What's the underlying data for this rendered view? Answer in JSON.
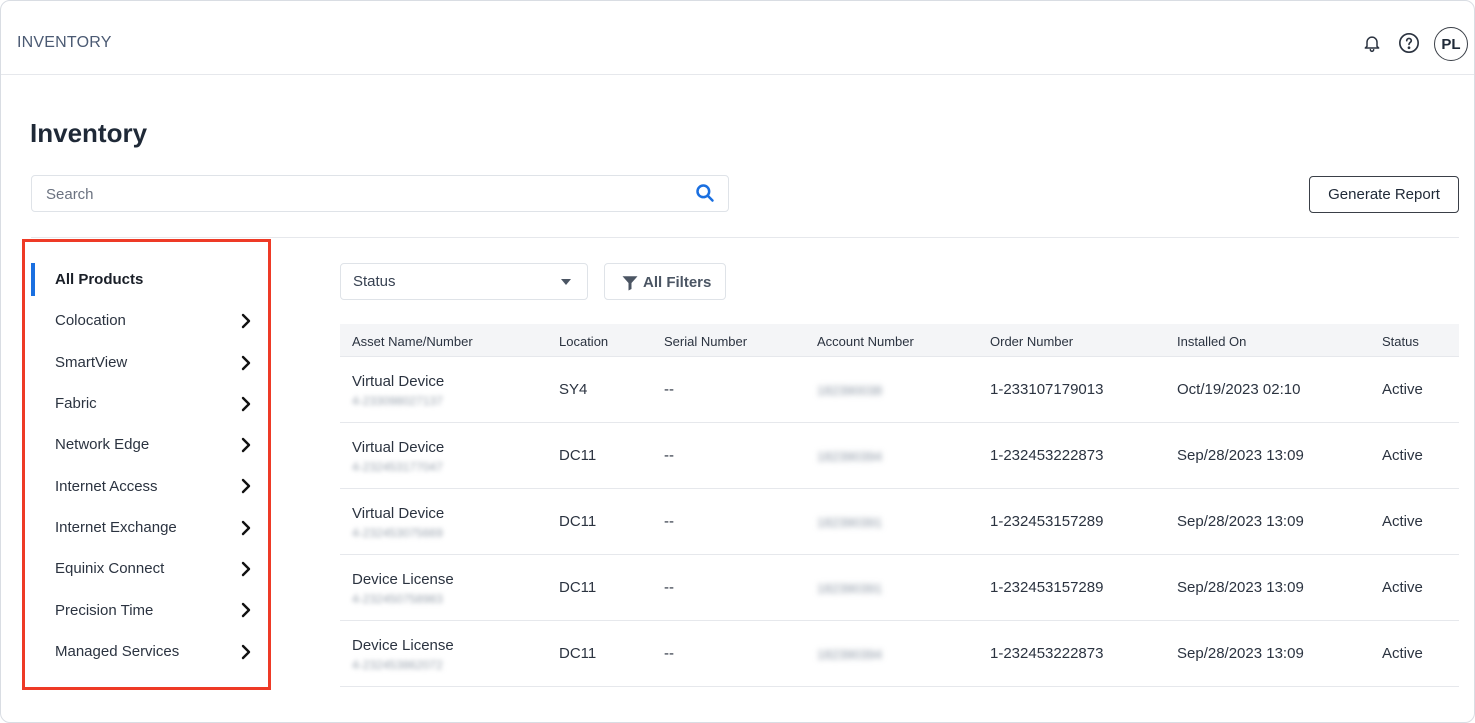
{
  "header": {
    "app_title": "INVENTORY",
    "avatar_initials": "PL",
    "icons": [
      "bell-icon",
      "help-icon"
    ]
  },
  "page": {
    "title": "Inventory"
  },
  "search": {
    "placeholder": "Search",
    "value": ""
  },
  "actions": {
    "generate_report": "Generate Report"
  },
  "sidebar": {
    "items": [
      {
        "label": "All Products",
        "active": true
      },
      {
        "label": "Colocation"
      },
      {
        "label": "SmartView"
      },
      {
        "label": "Fabric"
      },
      {
        "label": "Network Edge"
      },
      {
        "label": "Internet Access"
      },
      {
        "label": "Internet Exchange"
      },
      {
        "label": "Equinix Connect"
      },
      {
        "label": "Precision Time"
      },
      {
        "label": "Managed Services"
      }
    ]
  },
  "filters": {
    "status_label": "Status",
    "all_filters_label": "All Filters"
  },
  "table": {
    "columns": [
      "Asset Name/Number",
      "Location",
      "Serial Number",
      "Account Number",
      "Order Number",
      "Installed On",
      "Status"
    ],
    "rows": [
      {
        "name": "Virtual Device",
        "number": "4-233098027137",
        "location": "SY4",
        "serial": "--",
        "account": "182390038",
        "order": "1-233107179013",
        "installed": "Oct/19/2023 02:10",
        "status": "Active"
      },
      {
        "name": "Virtual Device",
        "number": "4-232453177047",
        "location": "DC11",
        "serial": "--",
        "account": "182390394",
        "order": "1-232453222873",
        "installed": "Sep/28/2023 13:09",
        "status": "Active"
      },
      {
        "name": "Virtual Device",
        "number": "4-232453075669",
        "location": "DC11",
        "serial": "--",
        "account": "182390391",
        "order": "1-232453157289",
        "installed": "Sep/28/2023 13:09",
        "status": "Active"
      },
      {
        "name": "Device License",
        "number": "4-232450758983",
        "location": "DC11",
        "serial": "--",
        "account": "182390391",
        "order": "1-232453157289",
        "installed": "Sep/28/2023 13:09",
        "status": "Active"
      },
      {
        "name": "Device License",
        "number": "4-232453862072",
        "location": "DC11",
        "serial": "--",
        "account": "182390394",
        "order": "1-232453222873",
        "installed": "Sep/28/2023 13:09",
        "status": "Active"
      }
    ]
  },
  "colors": {
    "accent": "#1a6fe0",
    "highlight": "#ee3a26"
  }
}
